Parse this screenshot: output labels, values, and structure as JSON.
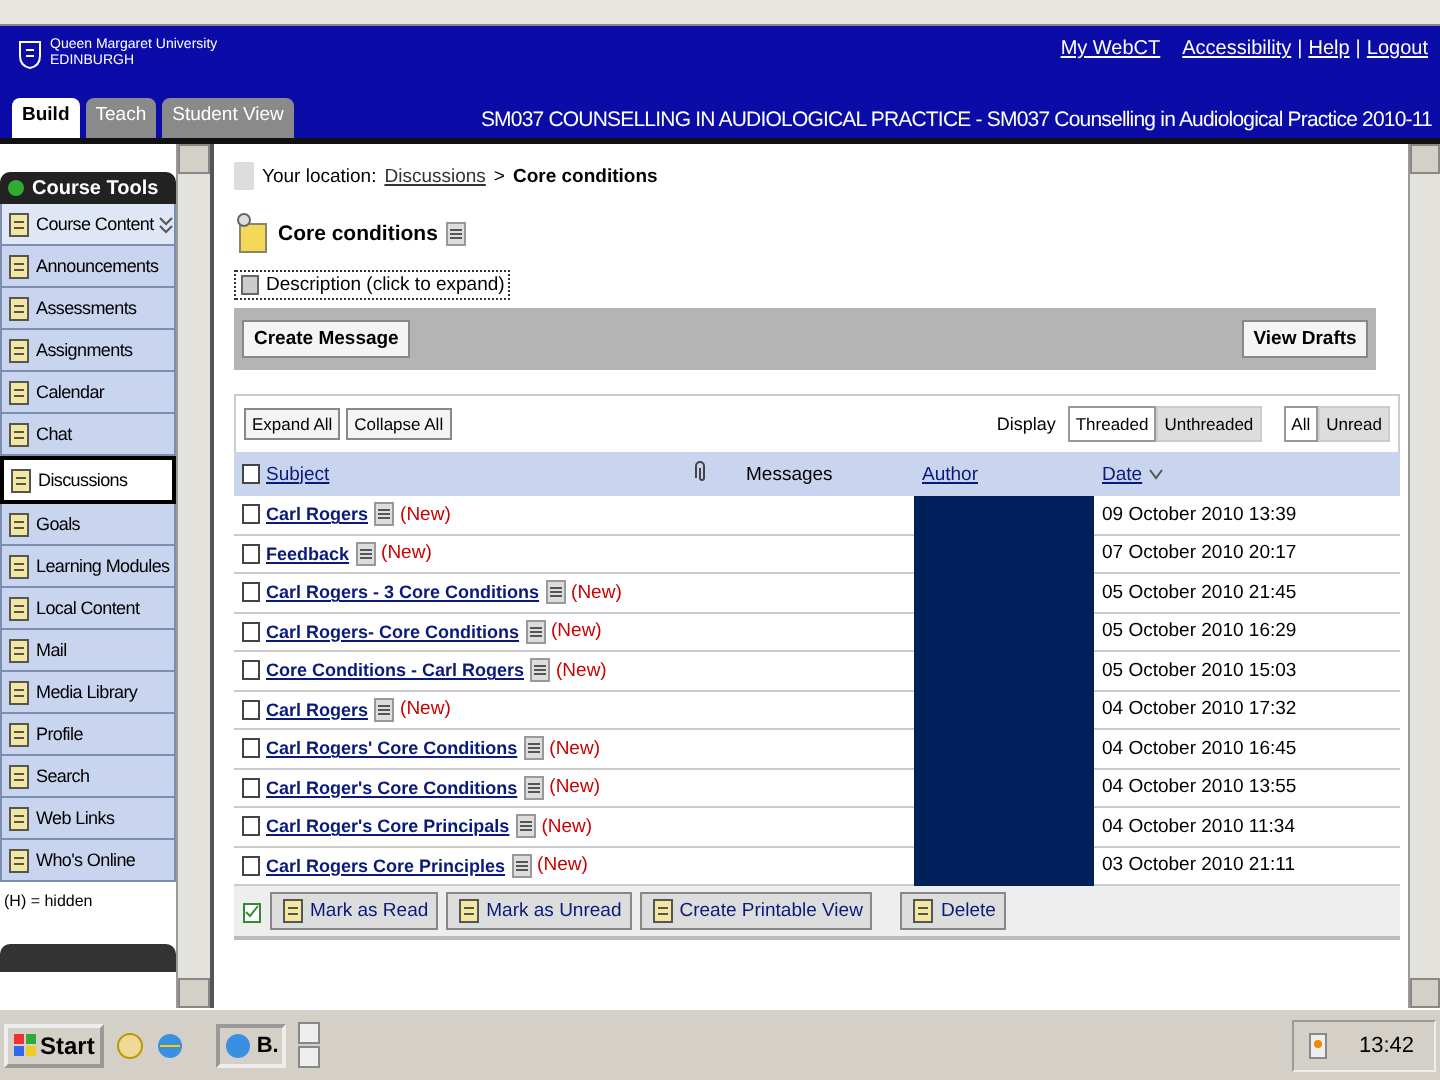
{
  "header": {
    "institution": "Queen Margaret University",
    "place": "EDINBURGH",
    "links": [
      "My WebCT",
      "Accessibility",
      "Help",
      "Logout"
    ],
    "link_separator": "|",
    "tabs": [
      {
        "label": "Build",
        "selected": true
      },
      {
        "label": "Teach",
        "selected": false
      },
      {
        "label": "Student View",
        "selected": false
      }
    ],
    "course_title": "SM037 COUNSELLING IN AUDIOLOGICAL PRACTICE - SM037 Counselling in Audiological Practice 2010-11"
  },
  "sidebar": {
    "title": "Course Tools",
    "items": [
      {
        "label": "Course Content",
        "selected": false,
        "kind": "folder"
      },
      {
        "label": "Announcements",
        "selected": false,
        "kind": "tool"
      },
      {
        "label": "Assessments",
        "selected": false,
        "kind": "tool"
      },
      {
        "label": "Assignments",
        "selected": false,
        "kind": "tool"
      },
      {
        "label": "Calendar",
        "selected": false,
        "kind": "tool"
      },
      {
        "label": "Chat",
        "selected": false,
        "kind": "tool"
      },
      {
        "label": "Discussions",
        "selected": true,
        "kind": "tool"
      },
      {
        "label": "Goals",
        "selected": false,
        "kind": "tool"
      },
      {
        "label": "Learning Modules",
        "selected": false,
        "kind": "tool"
      },
      {
        "label": "Local Content",
        "selected": false,
        "kind": "tool"
      },
      {
        "label": "Mail",
        "selected": false,
        "kind": "tool"
      },
      {
        "label": "Media Library",
        "selected": false,
        "kind": "tool"
      },
      {
        "label": "Profile",
        "selected": false,
        "kind": "tool"
      },
      {
        "label": "Search",
        "selected": false,
        "kind": "tool"
      },
      {
        "label": "Web Links",
        "selected": false,
        "kind": "tool"
      },
      {
        "label": "Who's Online",
        "selected": false,
        "kind": "tool"
      }
    ],
    "footnote": "(H) = hidden"
  },
  "breadcrumb": {
    "prefix": "Your location:",
    "link": "Discussions",
    "separator": ">",
    "current": "Core conditions"
  },
  "topic": {
    "title": "Core conditions",
    "description": "Description (click to expand)"
  },
  "action_bar": {
    "left": "Create Message",
    "right": "View Drafts"
  },
  "toolbar": {
    "buttons": [
      "Expand All",
      "Collapse All"
    ],
    "display_label": "Display",
    "display_options": [
      {
        "label": "Threaded",
        "selected": true
      },
      {
        "label": "Unthreaded",
        "selected": false
      }
    ],
    "filter_options": [
      {
        "label": "All",
        "selected": true
      },
      {
        "label": "Unread",
        "selected": false
      }
    ]
  },
  "table": {
    "columns": [
      "Subject",
      "Messages",
      "Author",
      "Date"
    ],
    "select_all": false,
    "rows": [
      {
        "subject": "Carl Rogers",
        "badge": "(New)",
        "date": "09 October 2010 13:39",
        "checked": false
      },
      {
        "subject": "Feedback",
        "badge": "(New)",
        "date": "07 October 2010 20:17",
        "checked": false
      },
      {
        "subject": "Carl Rogers - 3 Core Conditions",
        "badge": "(New)",
        "date": "05 October 2010 21:45",
        "checked": false
      },
      {
        "subject": "Carl Rogers- Core Conditions",
        "badge": "(New)",
        "date": "05 October 2010 16:29",
        "checked": false
      },
      {
        "subject": "Core Conditions - Carl Rogers",
        "badge": "(New)",
        "date": "05 October 2010 15:03",
        "checked": false
      },
      {
        "subject": "Carl Rogers",
        "badge": "(New)",
        "date": "04 October 2010 17:32",
        "checked": false
      },
      {
        "subject": "Carl Rogers' Core Conditions",
        "badge": "(New)",
        "date": "04 October 2010 16:45",
        "checked": false
      },
      {
        "subject": "Carl Roger's Core Conditions",
        "badge": "(New)",
        "date": "04 October 2010 13:55",
        "checked": false
      },
      {
        "subject": "Carl Roger's Core Principals",
        "badge": "(New)",
        "date": "04 October 2010 11:34",
        "checked": false
      },
      {
        "subject": "Carl Rogers Core Principles",
        "badge": "(New)",
        "date": "03 October 2010 21:11",
        "checked": false
      }
    ]
  },
  "bottom_actions": [
    "Mark as Read",
    "Mark as Unread",
    "Create Printable View",
    "Delete"
  ],
  "taskbar": {
    "start": "Start",
    "window": "B.",
    "clock": "13:42"
  }
}
